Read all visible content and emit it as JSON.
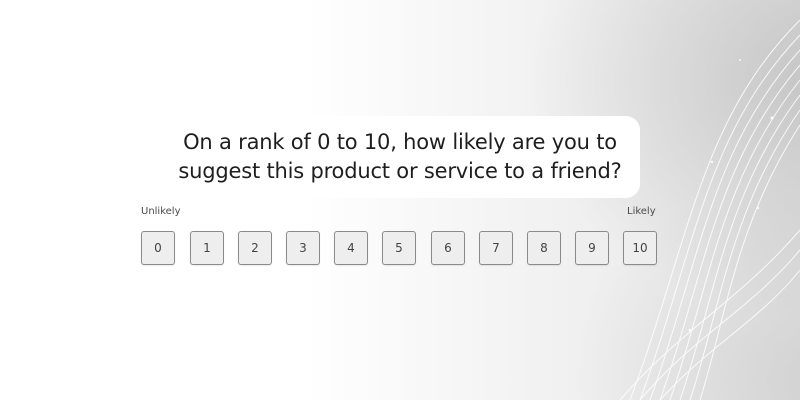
{
  "survey": {
    "question_line1": "On a rank of 0 to 10, how likely are you to",
    "question_line2": "suggest this product or service to a friend?",
    "label_low": "Unlikely",
    "label_high": "Likely",
    "options": [
      "0",
      "1",
      "2",
      "3",
      "4",
      "5",
      "6",
      "7",
      "8",
      "9",
      "10"
    ]
  },
  "colors": {
    "background": "#ffffff",
    "card": "#ffffff",
    "text": "#1e1e1e",
    "button_fill": "#eeeeee",
    "button_border": "#8a8a8a"
  }
}
